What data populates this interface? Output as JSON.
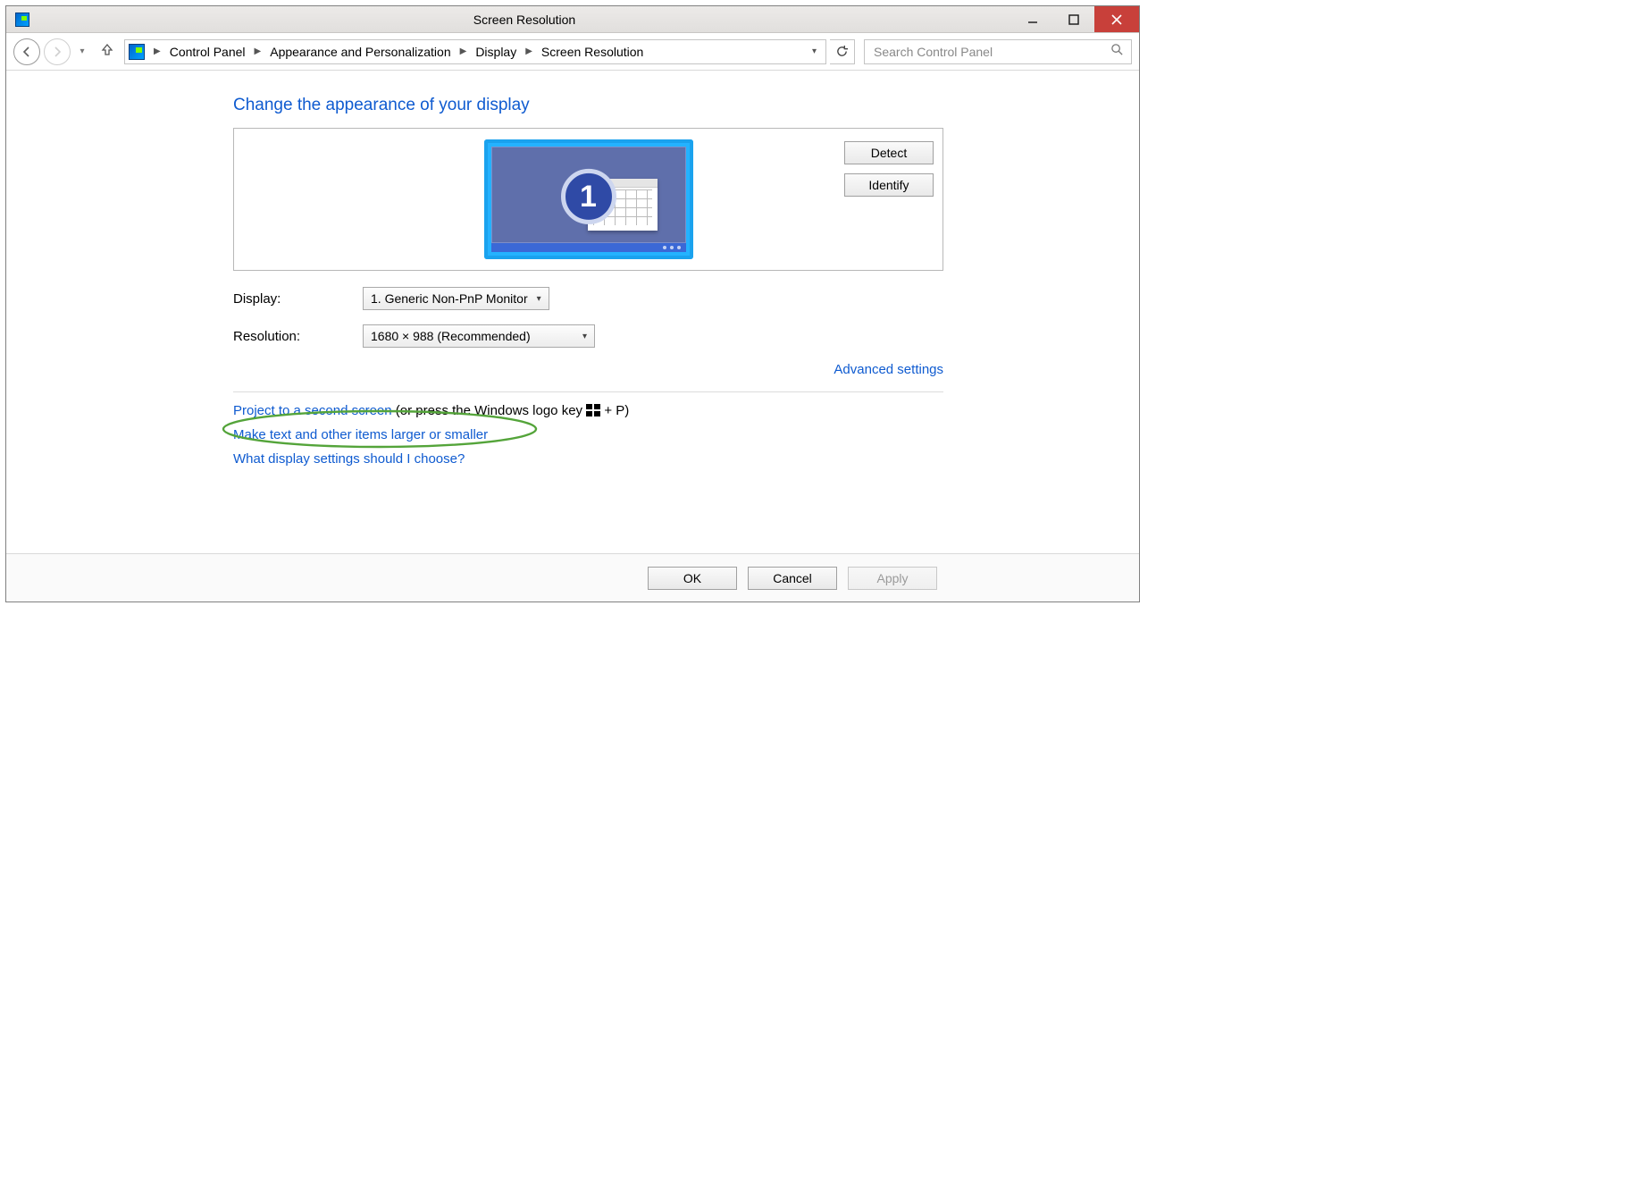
{
  "window": {
    "title": "Screen Resolution"
  },
  "breadcrumb": {
    "items": [
      "Control Panel",
      "Appearance and Personalization",
      "Display",
      "Screen Resolution"
    ]
  },
  "search": {
    "placeholder": "Search Control Panel"
  },
  "page": {
    "heading": "Change the appearance of your display",
    "detect_label": "Detect",
    "identify_label": "Identify",
    "monitor_number": "1",
    "display_label": "Display:",
    "display_value": "1. Generic Non-PnP Monitor",
    "resolution_label": "Resolution:",
    "resolution_value": "1680 × 988 (Recommended)",
    "advanced_link": "Advanced settings",
    "project_link": "Project to a second screen",
    "project_suffix_a": " (or press the Windows logo key ",
    "project_suffix_b": " + P)",
    "scale_link": "Make text and other items larger or smaller",
    "help_link": "What display settings should I choose?"
  },
  "buttons": {
    "ok": "OK",
    "cancel": "Cancel",
    "apply": "Apply"
  }
}
